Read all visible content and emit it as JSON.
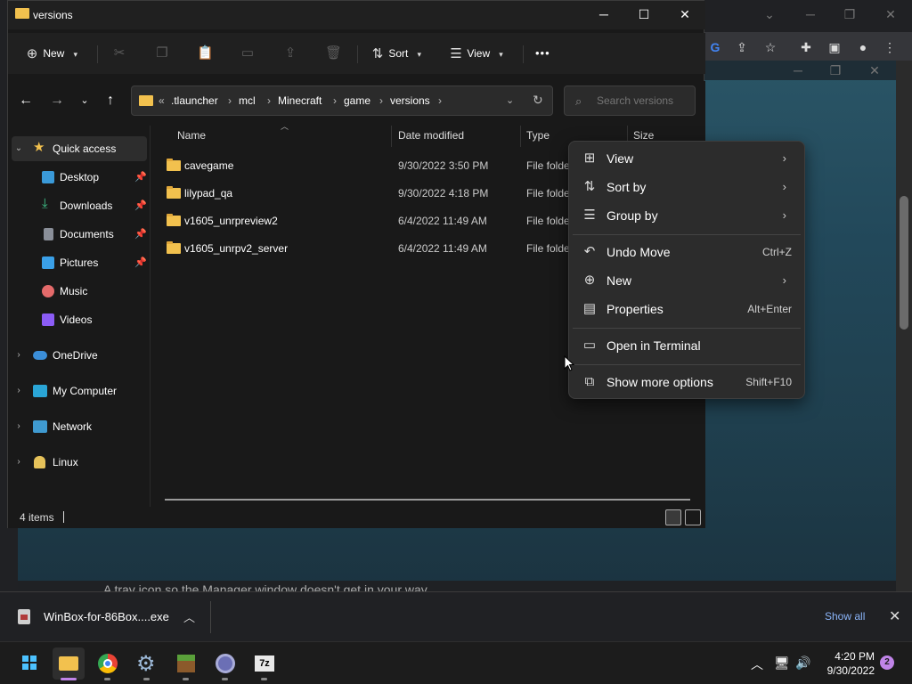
{
  "explorer": {
    "title": "versions",
    "toolbar": {
      "new_label": "New",
      "sort_label": "Sort",
      "view_label": "View",
      "more_label": "•••"
    },
    "breadcrumbs": [
      ".tlauncher",
      "mcl",
      "Minecraft",
      "game",
      "versions"
    ],
    "breadcrumb_prefix": "«",
    "search_placeholder": "Search versions",
    "sidebar": {
      "items": [
        {
          "label": "Quick access",
          "icon": "star-icon"
        },
        {
          "label": "Desktop",
          "icon": "desktop-icon"
        },
        {
          "label": "Downloads",
          "icon": "download-icon"
        },
        {
          "label": "Documents",
          "icon": "documents-icon"
        },
        {
          "label": "Pictures",
          "icon": "pictures-icon"
        },
        {
          "label": "Music",
          "icon": "music-icon"
        },
        {
          "label": "Videos",
          "icon": "videos-icon"
        },
        {
          "label": "OneDrive",
          "icon": "cloud-icon"
        },
        {
          "label": "My Computer",
          "icon": "computer-icon"
        },
        {
          "label": "Network",
          "icon": "network-icon"
        },
        {
          "label": "Linux",
          "icon": "linux-icon"
        }
      ]
    },
    "columns": {
      "name": "Name",
      "date": "Date modified",
      "type": "Type",
      "size": "Size"
    },
    "files": [
      {
        "name": "cavegame",
        "date": "9/30/2022 3:50 PM",
        "type": "File folder"
      },
      {
        "name": "lilypad_qa",
        "date": "9/30/2022 4:18 PM",
        "type": "File folder"
      },
      {
        "name": "v1605_unrpreview2",
        "date": "6/4/2022 11:49 AM",
        "type": "File folder"
      },
      {
        "name": "v1605_unrpv2_server",
        "date": "6/4/2022 11:49 AM",
        "type": "File folder"
      }
    ],
    "status": "4 items"
  },
  "context_menu": {
    "items": [
      {
        "label": "View",
        "icon": "grid-icon",
        "accel": "",
        "submenu": true
      },
      {
        "label": "Sort by",
        "icon": "sort-icon",
        "accel": "",
        "submenu": true
      },
      {
        "label": "Group by",
        "icon": "list-icon",
        "accel": "",
        "submenu": true
      },
      {
        "label": "Undo Move",
        "icon": "undo-icon",
        "accel": "Ctrl+Z",
        "submenu": false
      },
      {
        "label": "New",
        "icon": "plus-circle-icon",
        "accel": "",
        "submenu": true
      },
      {
        "label": "Properties",
        "icon": "properties-icon",
        "accel": "Alt+Enter",
        "submenu": false
      },
      {
        "label": "Open in Terminal",
        "icon": "terminal-icon",
        "accel": "",
        "submenu": false
      },
      {
        "label": "Show more options",
        "icon": "more-options-icon",
        "accel": "Shift+F10",
        "submenu": false
      }
    ]
  },
  "download_bar": {
    "file_name": "WinBox-for-86Box....exe",
    "show_all": "Show all"
  },
  "background_text": "A tray icon so the Manager window doesn't get in your way",
  "taskbar": {
    "time": "4:20 PM",
    "date": "9/30/2022",
    "notification_count": "2",
    "apps": [
      "start",
      "file-explorer",
      "chrome",
      "settings",
      "minecraft",
      "edge-beta",
      "7zip"
    ]
  },
  "colors": {
    "accent": "#4cc2ff",
    "folder": "#f2c14e",
    "link": "#8ab4f8",
    "menu_bg": "#2c2c2c"
  }
}
